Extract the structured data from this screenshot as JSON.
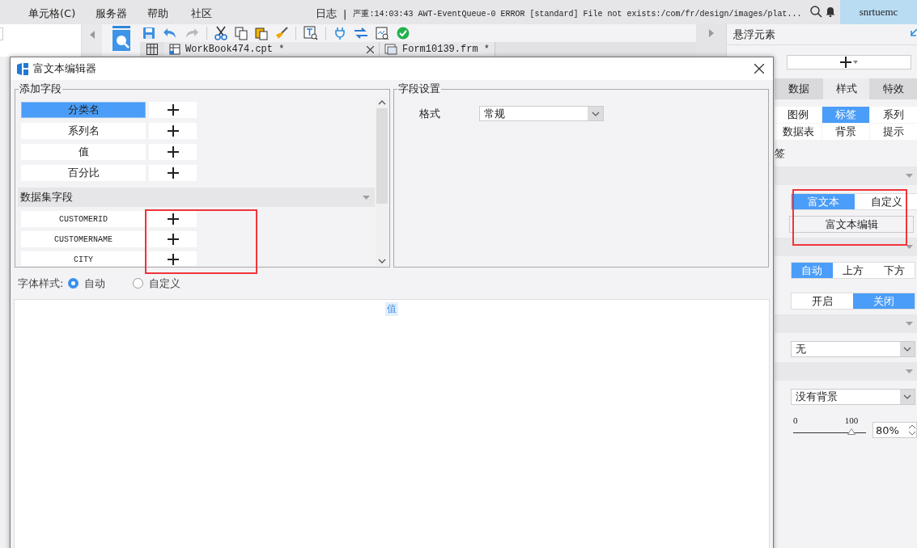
{
  "menu_bar": {
    "items": [
      "单元格(C)",
      "服务器",
      "帮助",
      "社区"
    ],
    "log_label": "日志",
    "log_separator": "|",
    "log_message": "严重:14:03:43 AWT-EventQueue-0 ERROR [standard] File not exists:/com/fr/design/images/plat...",
    "user": "snrtuemc"
  },
  "file_tabs": [
    {
      "title": "WorkBook474.cpt *",
      "kind": "workbook"
    },
    {
      "title": "Form10139.frm *",
      "kind": "form"
    }
  ],
  "float_panel": {
    "title": "悬浮元素",
    "tabs": [
      {
        "label": "数据",
        "selected": false
      },
      {
        "label": "样式",
        "selected": true
      },
      {
        "label": "特效",
        "selected": false
      }
    ],
    "sub_tabs": [
      {
        "label": "图例",
        "selected": false
      },
      {
        "label": "标签",
        "selected": true
      },
      {
        "label": "系列",
        "selected": false
      },
      {
        "label": "数据表",
        "selected": false
      },
      {
        "label": "背景",
        "selected": false
      },
      {
        "label": "提示",
        "selected": false
      }
    ],
    "partial_label": "签",
    "label_mode": [
      {
        "label": "富文本",
        "selected": true
      },
      {
        "label": "自定义",
        "selected": false
      }
    ],
    "highlighted": true,
    "edit_button": "富文本编辑",
    "position": [
      {
        "label": "自动",
        "selected": true
      },
      {
        "label": "上方",
        "selected": false
      },
      {
        "label": "下方",
        "selected": false
      }
    ],
    "switch": [
      {
        "label": "开启",
        "selected": false
      },
      {
        "label": "关闭",
        "selected": true
      }
    ],
    "border_select": "无",
    "background_select": "没有背景",
    "opacity": {
      "min_label": "0",
      "max_label": "100",
      "level": 0.8,
      "value": "80%"
    }
  },
  "dialog": {
    "title": "富文本编辑器",
    "add_fields": {
      "legend": "添加字段",
      "fields": [
        {
          "label": "分类名",
          "selected": true
        },
        {
          "label": "系列名",
          "selected": false
        },
        {
          "label": "值",
          "selected": false
        },
        {
          "label": "百分比",
          "selected": false
        }
      ],
      "dataset_header": "数据集字段",
      "dataset_fields": [
        {
          "label": "CUSTOMERID"
        },
        {
          "label": "CUSTOMERNAME"
        },
        {
          "label": "CITY"
        }
      ],
      "highlighted": true
    },
    "field_settings": {
      "legend": "字段设置",
      "format_label": "格式",
      "format_value": "常规"
    },
    "font_style": {
      "label": "字体样式:",
      "options": [
        {
          "label": "自动",
          "selected": true
        },
        {
          "label": "自定义",
          "selected": false
        }
      ]
    },
    "editor": {
      "content": "值"
    }
  }
}
